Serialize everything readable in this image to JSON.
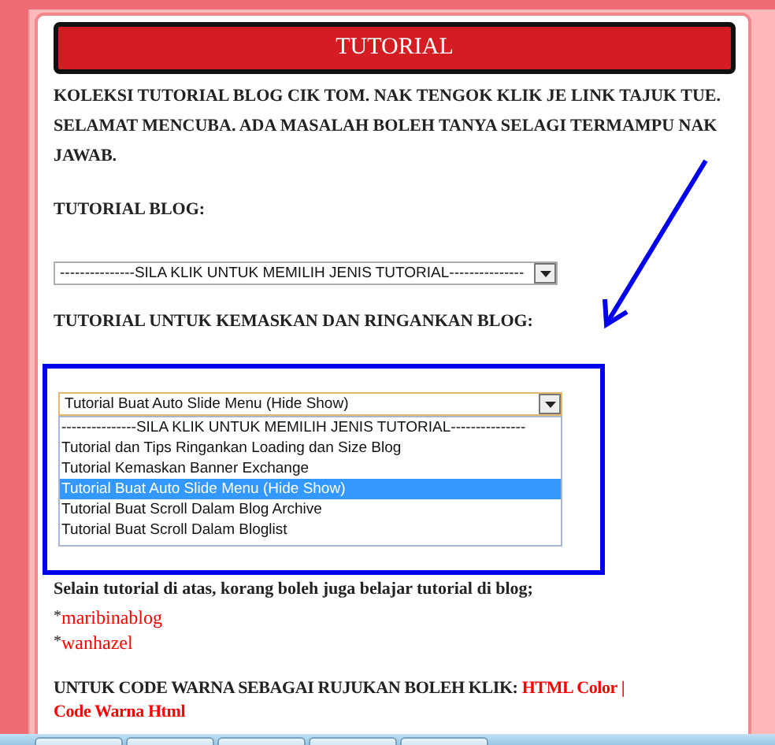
{
  "title": "TUTORIAL",
  "intro": "KOLEKSI TUTORIAL BLOG CIK TOM. NAK TENGOK KLIK JE LINK TAJUK TUE. SELAMAT MENCUBA. ADA MASALAH BOLEH TANYA SELAGI TERMAMPU NAK JAWAB.",
  "blog_label": "TUTORIAL BLOG:",
  "blog_select": {
    "value": "---------------SILA KLIK UNTUK MEMILIH JENIS TUTORIAL---------------"
  },
  "light_label": "TUTORIAL UNTUK KEMASKAN DAN RINGANKAN BLOG:",
  "light_select": {
    "value": "Tutorial Buat Auto Slide Menu (Hide Show)",
    "expanded": true,
    "options": [
      {
        "label": "---------------SILA KLIK UNTUK MEMILIH JENIS TUTORIAL---------------",
        "selected": false
      },
      {
        "label": "Tutorial dan Tips Ringankan Loading dan Size Blog",
        "selected": false
      },
      {
        "label": "Tutorial Kemaskan Banner Exchange",
        "selected": false
      },
      {
        "label": "Tutorial Buat Auto Slide Menu (Hide Show)",
        "selected": true
      },
      {
        "label": "Tutorial Buat Scroll Dalam Blog Archive",
        "selected": false
      },
      {
        "label": "Tutorial Buat Scroll Dalam Bloglist",
        "selected": false
      }
    ]
  },
  "other_text": "Selain tutorial di atas, korang boleh juga belajar tutorial di blog;",
  "blog_links": [
    {
      "bullet": "*",
      "label": "maribinablog"
    },
    {
      "bullet": "*",
      "label": "wanhazel"
    }
  ],
  "color_text": "UNTUK CODE WARNA SEBAGAI RUJUKAN BOLEH KLIK:",
  "color_links": [
    {
      "label": "HTML Color"
    },
    {
      "label": "|"
    },
    {
      "label": "Code Warna Html"
    }
  ]
}
